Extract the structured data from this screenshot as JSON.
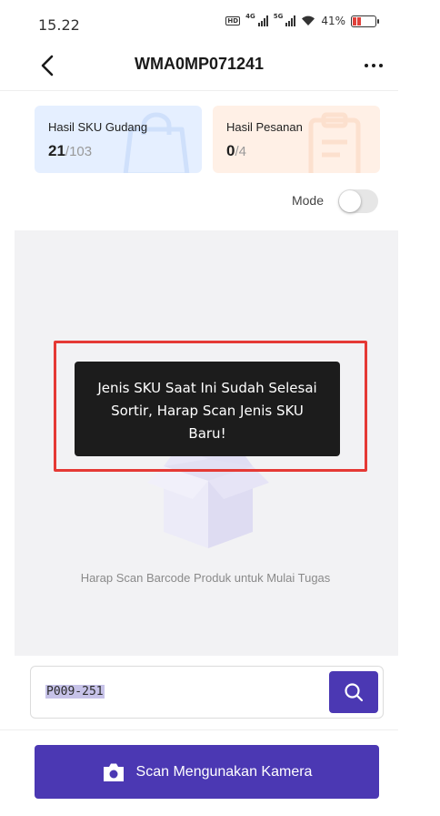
{
  "status_bar": {
    "time": "15.22",
    "hd_badge": "HD",
    "net_4g": "4G",
    "net_5g": "5G",
    "battery_percent": "41%"
  },
  "header": {
    "title": "WMA0MP071241",
    "back_icon": "chevron-left-icon",
    "more_icon": "more-horizontal-icon"
  },
  "cards": {
    "sku": {
      "label": "Hasil SKU Gudang",
      "current": "21",
      "total": "/103",
      "icon": "shopping-bag-icon",
      "bg": "#e5efff"
    },
    "order": {
      "label": "Hasil Pesanan",
      "current": "0",
      "total": "/4",
      "icon": "clipboard-icon",
      "bg": "#fff0e6"
    }
  },
  "mode": {
    "label": "Mode",
    "enabled": false
  },
  "main": {
    "toast": "Jenis SKU Saat Ini Sudah Selesai Sortir, Harap Scan Jenis SKU Baru!",
    "empty_text": "Harap Scan Barcode Produk untuk Mulai Tugas",
    "empty_icon": "open-box-icon"
  },
  "search": {
    "value": "P009-251",
    "icon": "search-icon"
  },
  "camera_button": {
    "label": "Scan Mengunakan Kamera",
    "icon": "camera-icon"
  },
  "colors": {
    "accent": "#4b38b3",
    "highlight": "#e53935"
  }
}
